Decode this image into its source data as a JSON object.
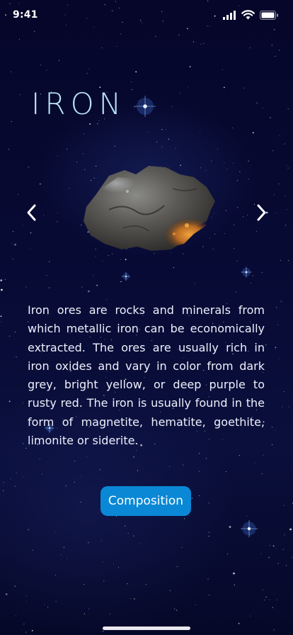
{
  "status_bar": {
    "time": "9:41",
    "icons": [
      "cellular-signal-icon",
      "wifi-icon",
      "battery-icon"
    ]
  },
  "mineral": {
    "name": "IRON",
    "description": "Iron ores are rocks and minerals from which metallic iron can be economically extracted. The ores are usually rich in iron oxides and vary in color from dark grey, bright yellow, or deep purple to rusty red. The iron is usually found in the form of magnetite, hematite, goethite, limonite or siderite."
  },
  "carousel": {
    "prev_icon": "chevron-left-icon",
    "next_icon": "chevron-right-icon",
    "image": "iron-ore-rock-image"
  },
  "actions": {
    "composition_label": "Composition"
  },
  "colors": {
    "background": "#070a33",
    "title": "#b9e3f8",
    "button": "#0a88d6",
    "text": "#eef0fb"
  }
}
